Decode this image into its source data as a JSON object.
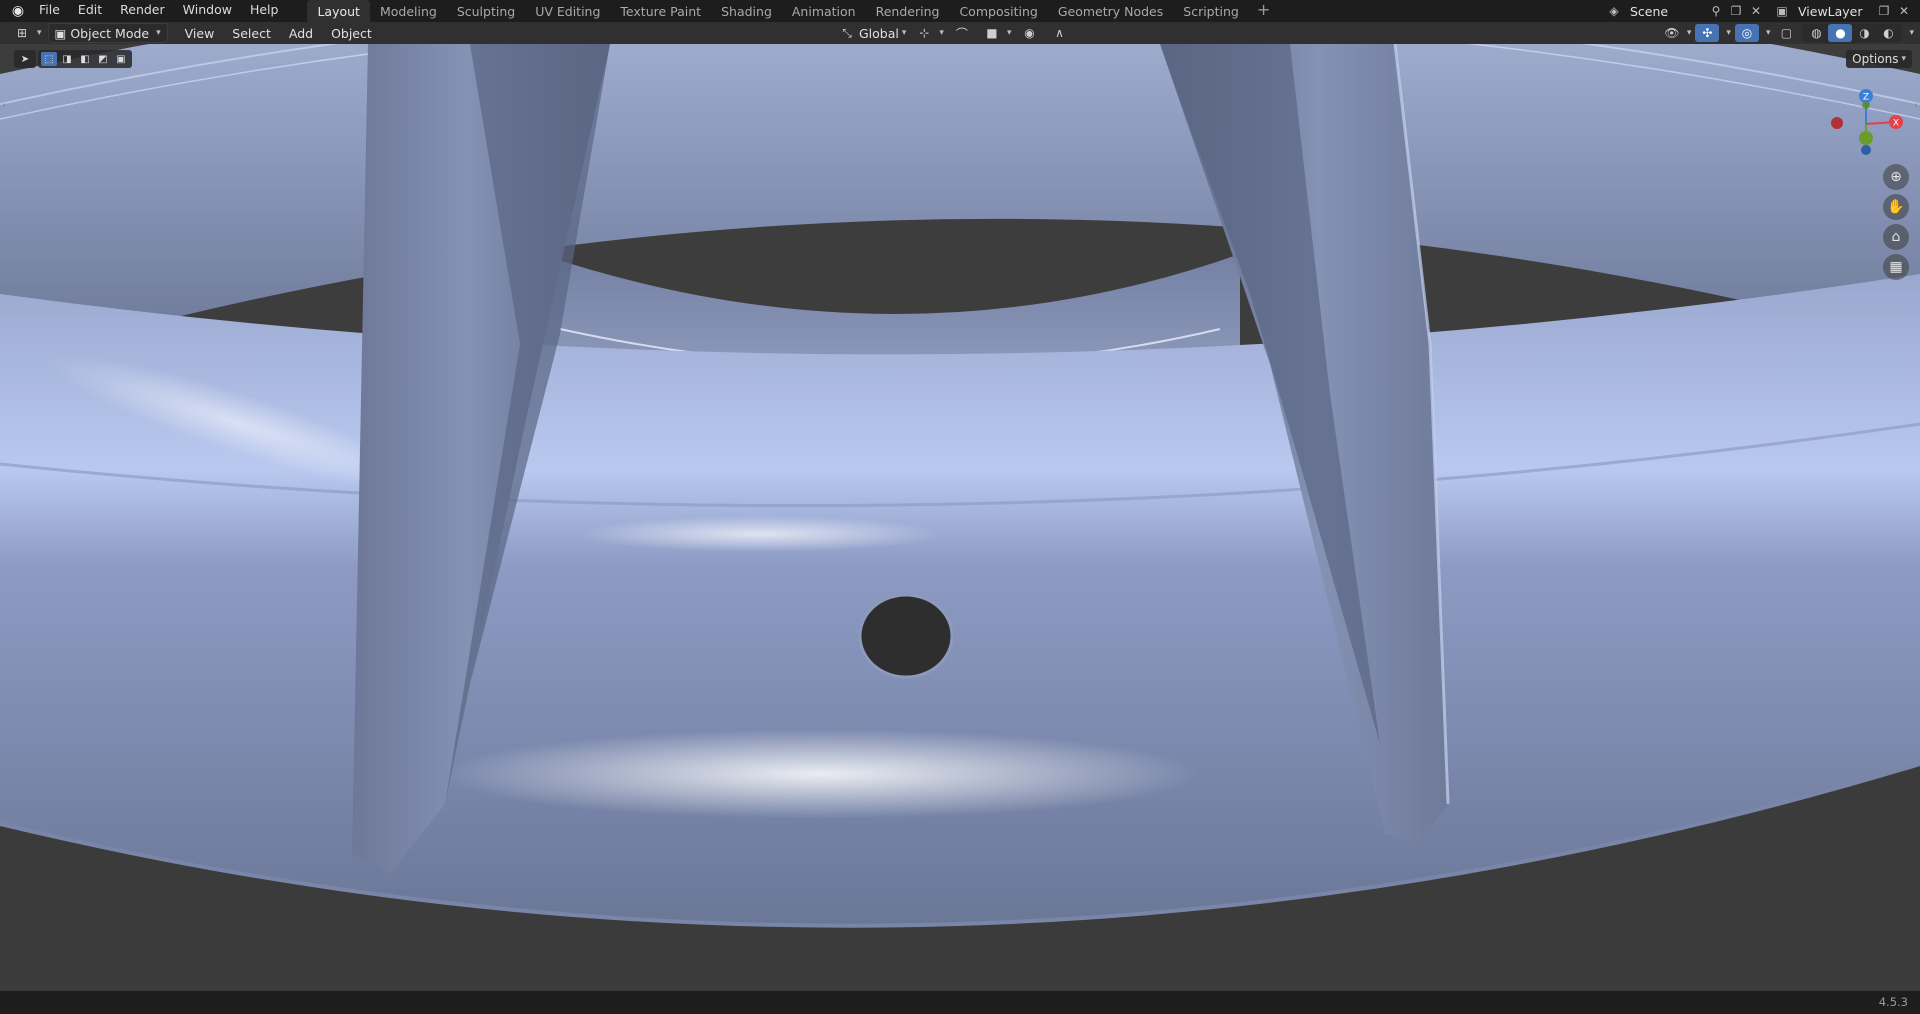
{
  "topbar": {
    "menus": [
      "File",
      "Edit",
      "Render",
      "Window",
      "Help"
    ],
    "workspaces": [
      "Layout",
      "Modeling",
      "Sculpting",
      "UV Editing",
      "Texture Paint",
      "Shading",
      "Animation",
      "Rendering",
      "Compositing",
      "Geometry Nodes",
      "Scripting"
    ],
    "active_workspace": "Layout",
    "add_workspace": "+",
    "scene": "Scene",
    "view_layer": "ViewLayer"
  },
  "header": {
    "mode": "Object Mode",
    "menus": [
      "View",
      "Select",
      "Add",
      "Object"
    ],
    "transform_orientation": "Global",
    "options_label": "Options"
  },
  "status": {
    "version": "4.5.3"
  },
  "colors": {
    "accent": "#4772b3",
    "axis_x": "#e5414a",
    "axis_y": "#6b9c2a",
    "axis_z": "#3b7fd8",
    "background": "#303030"
  },
  "icons": {
    "logo": "blender-logo-icon",
    "nav": [
      "zoom-icon",
      "hand-pan-icon",
      "camera-view-icon",
      "ortho-grid-icon"
    ]
  }
}
